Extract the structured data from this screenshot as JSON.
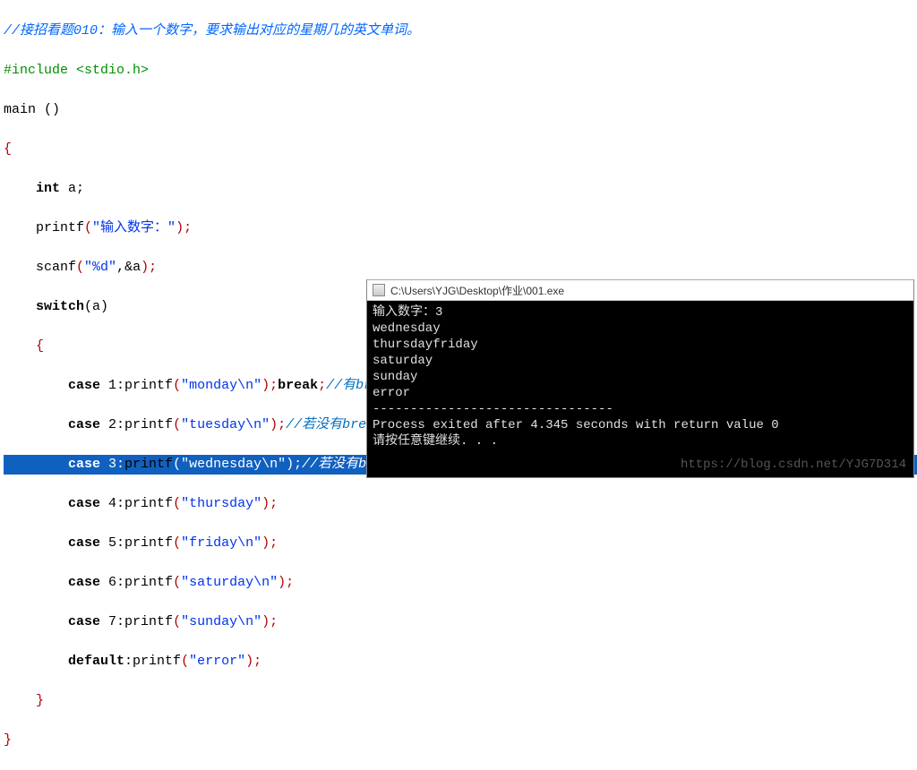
{
  "code": {
    "comment_top": "//接招看题010：输入一个数字，要求输出对应的星期几的英文单词。",
    "include": "#include <stdio.h>",
    "main": "main ()",
    "lbrace": "{",
    "decl_kw": "int",
    "decl_rest": " a;",
    "printf1_fn": "printf",
    "printf1_str": "\"输入数字：\"",
    "scanf_fn": "scanf",
    "scanf_str": "\"%d\"",
    "scanf_arg": ",&a",
    "switch_kw": "switch",
    "switch_arg": "(a)",
    "sw_lbrace": "{",
    "case1_kw": "case",
    "case1_num": " 1:",
    "case1_fn": "printf",
    "case1_str": "\"monday\\n\"",
    "case1_break": "break",
    "case1_cm": "//有break ,直接跳出switch",
    "case2_kw": "case",
    "case2_num": " 2:",
    "case2_fn": "printf",
    "case2_str": "\"tuesday\\n\"",
    "case2_cm": "//若没有break语句，则就会从匹配的标签开始执行到switch末",
    "case3_kw": "case",
    "case3_num": " 3:",
    "case3_fn": "printf",
    "case3_str": "\"wednesday\\n\"",
    "case3_cm": "//若没有break语句，则就会从匹配的标签开始执行到switch",
    "case4_kw": "case",
    "case4_num": " 4:",
    "case4_fn": "printf",
    "case4_str": "\"thursday\"",
    "case5_kw": "case",
    "case5_num": " 5:",
    "case5_fn": "printf",
    "case5_str": "\"friday\\n\"",
    "case6_kw": "case",
    "case6_num": " 6:",
    "case6_fn": "printf",
    "case6_str": "\"saturday\\n\"",
    "case7_kw": "case",
    "case7_num": " 7:",
    "case7_fn": "printf",
    "case7_str": "\"sunday\\n\"",
    "default_kw": "default",
    "default_fn": "printf",
    "default_str": "\"error\"",
    "sw_rbrace": "}",
    "rbrace": "}"
  },
  "console": {
    "title": "C:\\Users\\YJG\\Desktop\\作业\\001.exe",
    "lines": [
      "输入数字：3",
      "wednesday",
      "thursdayfriday",
      "saturday",
      "sunday",
      "error",
      "--------------------------------",
      "Process exited after 4.345 seconds with return value 0",
      "请按任意键继续. . ."
    ]
  },
  "watermark": "https://blog.csdn.net/YJG7D314"
}
